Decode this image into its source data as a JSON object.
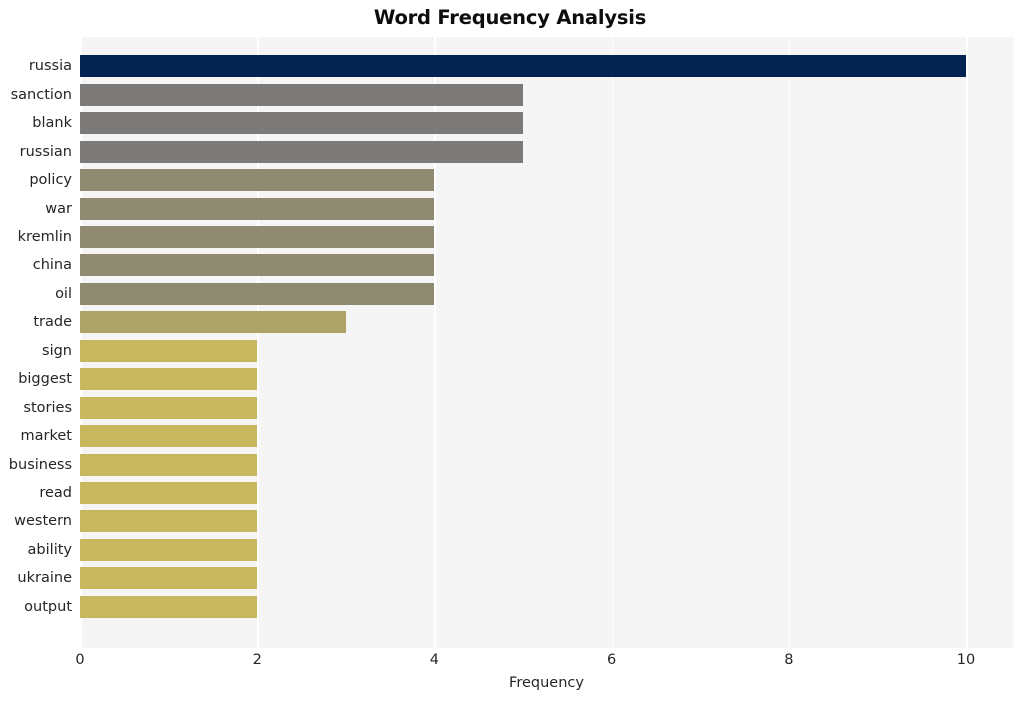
{
  "chart_data": {
    "type": "bar",
    "orientation": "horizontal",
    "title": "Word Frequency Analysis",
    "xlabel": "Frequency",
    "ylabel": "",
    "xlim": [
      0,
      10.53
    ],
    "xticks": [
      0,
      2,
      4,
      6,
      8,
      10
    ],
    "xtick_labels": [
      "0",
      "2",
      "4",
      "6",
      "8",
      "10"
    ],
    "grid": "vertical-only",
    "legend": "none",
    "categories": [
      "russia",
      "sanction",
      "blank",
      "russian",
      "policy",
      "war",
      "kremlin",
      "china",
      "oil",
      "trade",
      "sign",
      "biggest",
      "stories",
      "market",
      "business",
      "read",
      "western",
      "ability",
      "ukraine",
      "output"
    ],
    "values": [
      10,
      5,
      5,
      5,
      4,
      4,
      4,
      4,
      4,
      3,
      2,
      2,
      2,
      2,
      2,
      2,
      2,
      2,
      2,
      2
    ],
    "bar_colors": [
      "#052351",
      "#7b7a78",
      "#7b7a78",
      "#7b7a78",
      "#8f8b73",
      "#8f8b73",
      "#8f8b73",
      "#8f8b73",
      "#8f8b73",
      "#ada268",
      "#c8b75f",
      "#c8b75f",
      "#c8b75f",
      "#c8b75f",
      "#c8b75f",
      "#c8b75f",
      "#c8b75f",
      "#c8b75f",
      "#c8b75f",
      "#c8b75f"
    ],
    "plot_background": "#f5f5f6",
    "gridline_color": "#ffffff",
    "figure_background": "#ffffff"
  }
}
